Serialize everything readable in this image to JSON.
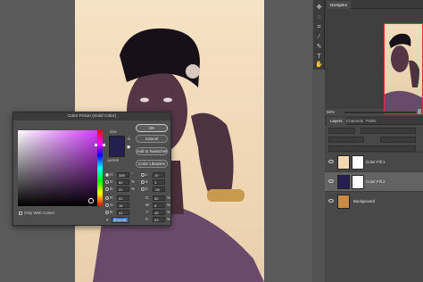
{
  "picker": {
    "title": "Color Picker (Solid Color)",
    "new_label": "new",
    "current_label": "current",
    "buttons": {
      "ok": "OK",
      "cancel": "Cancel",
      "add_swatches": "Add to Swatches",
      "libraries": "Color Libraries"
    },
    "only_web_colors": "Only Web Colors",
    "hsb": [
      {
        "label": "H:",
        "value": "288",
        "unit": "°"
      },
      {
        "label": "S:",
        "value": "60",
        "unit": "%"
      },
      {
        "label": "B:",
        "value": "31",
        "unit": "%"
      }
    ],
    "rgb": [
      {
        "label": "R:",
        "value": "51",
        "unit": ""
      },
      {
        "label": "G:",
        "value": "16",
        "unit": ""
      },
      {
        "label": "B:",
        "value": "41",
        "unit": ""
      }
    ],
    "lab": [
      {
        "label": "L:",
        "value": "10",
        "unit": ""
      },
      {
        "label": "a:",
        "value": "3",
        "unit": ""
      },
      {
        "label": "b:",
        "value": "-26",
        "unit": ""
      }
    ],
    "cmyk": [
      {
        "label": "C:",
        "value": "82",
        "unit": "%"
      },
      {
        "label": "M:",
        "value": "8",
        "unit": "%"
      },
      {
        "label": "Y:",
        "value": "45",
        "unit": "%"
      },
      {
        "label": "K:",
        "value": "63",
        "unit": "%"
      }
    ],
    "hex_label": "#",
    "hex_value": "2b1e4d",
    "selected_color": "#251f4f"
  },
  "panels": {
    "navigator_tab": "Navigator",
    "zoom": "66%",
    "tabs": [
      "Layers",
      "Channels",
      "Paths"
    ],
    "layers": [
      {
        "name": "Color Fill 1",
        "thumb_color": "#f2d7b3",
        "selected": false
      },
      {
        "name": "Color Fill 2",
        "thumb_color": "#251f4f",
        "selected": true
      },
      {
        "name": "Background",
        "thumb_color": "#c98a45",
        "selected": false
      }
    ]
  },
  "tools": {
    "icons": [
      "move-icon",
      "lasso-icon",
      "crop-icon",
      "eyedropper-icon",
      "brush-icon",
      "type-icon",
      "hand-icon"
    ]
  }
}
